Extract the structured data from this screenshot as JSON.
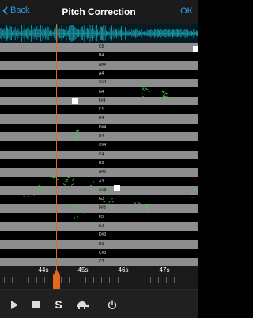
{
  "header": {
    "back_label": "Back",
    "title": "Pitch Correction",
    "ok_label": "OK"
  },
  "notes": [
    "C5",
    "B4",
    "A#4",
    "A4",
    "G#4",
    "G4",
    "F#4",
    "F4",
    "E4",
    "D#4",
    "D4",
    "C#4",
    "C4",
    "B3",
    "A#3",
    "A3",
    "G#3",
    "G3",
    "F#3",
    "F3",
    "E3",
    "D#3",
    "D3",
    "C#3",
    "C3"
  ],
  "timeline": {
    "labels": [
      "44s",
      "45s",
      "46s",
      "47s"
    ]
  },
  "toolbar": {
    "snap_label": "S"
  },
  "colors": {
    "accent": "#2f9be8",
    "playhead": "#e06a1a",
    "wave": "#1aa3b3",
    "pitch_trace": "#3cd33c"
  }
}
